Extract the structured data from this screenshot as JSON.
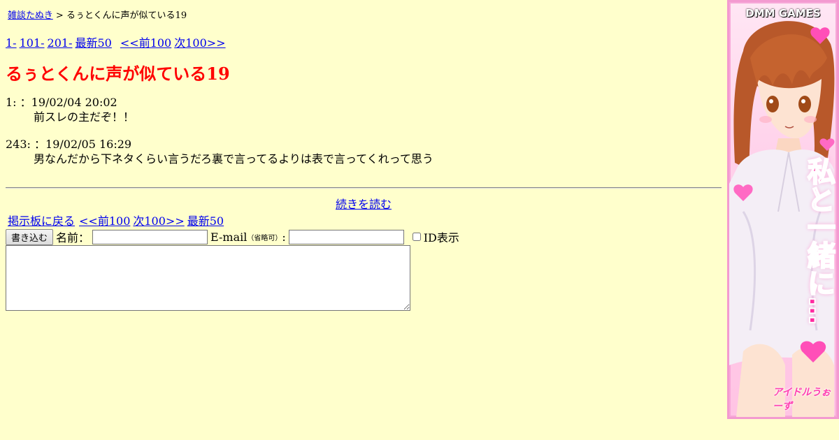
{
  "breadcrumb": {
    "board_link": "雑談たぬき",
    "separator": ">",
    "current": "るぅとくんに声が似ている19"
  },
  "pager_top": {
    "links": [
      "1-",
      "101-",
      "201-",
      "最新50"
    ],
    "prev": "<<前100",
    "next": "次100>>"
  },
  "thread": {
    "title": "るぅとくんに声が似ている19"
  },
  "posts": [
    {
      "header": "1: ：19/02/04 20:02",
      "body": "前スレの主だぞ！！"
    },
    {
      "header": "243: ：19/02/05 16:29",
      "body": "男なんだから下ネタくらい言うだろ裏で言ってるよりは表で言ってくれって思う"
    }
  ],
  "read_more": "続きを読む",
  "pager_bottom": {
    "back": "掲示板に戻る",
    "prev": "<<前100",
    "next": "次100>>",
    "latest": "最新50"
  },
  "form": {
    "submit_label": "書き込む",
    "name_label": "名前：",
    "name_value": "",
    "email_label": "E-mail",
    "email_note": "（省略可）",
    "email_colon": ":",
    "email_value": "",
    "id_label": "ID表示",
    "id_checked": false,
    "message_value": ""
  },
  "ad": {
    "brand": "DMM GAMES",
    "slogan": "私と一緒に…",
    "logo": "アイドルうぉーず",
    "colors": {
      "frame": "#f39ad0",
      "slogan": "#ff2aa0"
    }
  },
  "colors": {
    "background": "#ffffcc",
    "title": "#ff0000",
    "link": "#0000ee"
  }
}
